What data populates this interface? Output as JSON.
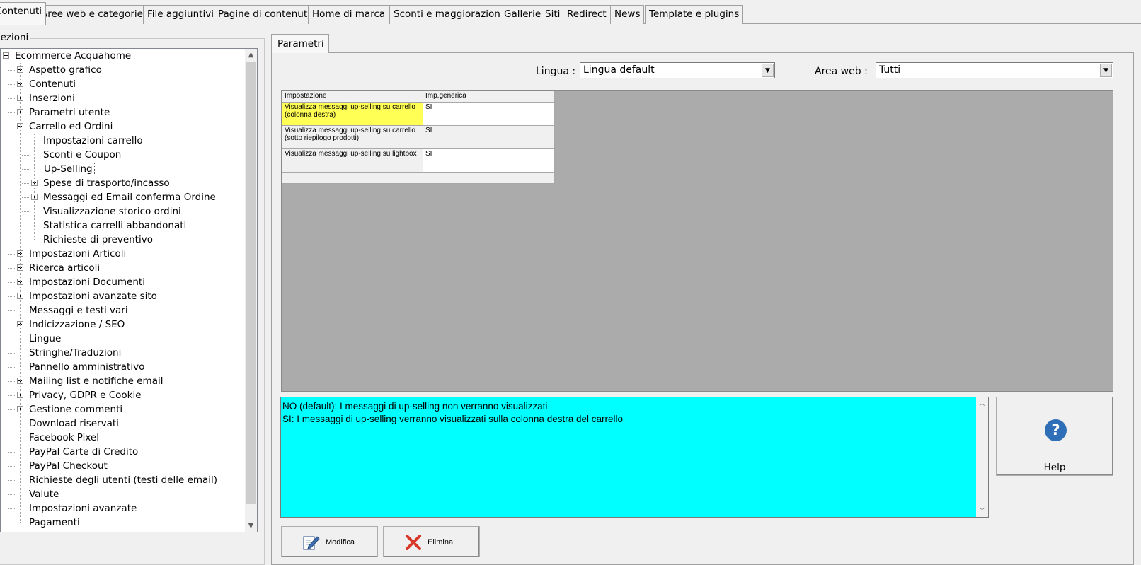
{
  "tabs": [
    {
      "label": "Contenuti",
      "active": true
    },
    {
      "label": "Aree web e categorie"
    },
    {
      "label": "File aggiuntivi"
    },
    {
      "label": "Pagine di contenuti"
    },
    {
      "label": "Home di marca"
    },
    {
      "label": "Sconti e maggiorazioni"
    },
    {
      "label": "Gallerie"
    },
    {
      "label": "Siti"
    },
    {
      "label": "Redirect"
    },
    {
      "label": "News"
    },
    {
      "label": "Template e plugins"
    }
  ],
  "sidebar": {
    "legend": "Sezioni",
    "tree": [
      {
        "label": "Ecommerce Acquahome",
        "level": 0,
        "toggle": "minus"
      },
      {
        "label": "Aspetto grafico",
        "level": 1,
        "toggle": "plus"
      },
      {
        "label": "Contenuti",
        "level": 1,
        "toggle": "plus"
      },
      {
        "label": "Inserzioni",
        "level": 1,
        "toggle": "plus"
      },
      {
        "label": "Parametri utente",
        "level": 1,
        "toggle": "plus"
      },
      {
        "label": "Carrello ed Ordini",
        "level": 1,
        "toggle": "minus"
      },
      {
        "label": "Impostazioni carrello",
        "level": 2
      },
      {
        "label": "Sconti e Coupon",
        "level": 2
      },
      {
        "label": "Up-Selling",
        "level": 2,
        "selected": true
      },
      {
        "label": "Spese di trasporto/incasso",
        "level": 2,
        "toggle": "plus"
      },
      {
        "label": "Messaggi ed Email conferma Ordine",
        "level": 2,
        "toggle": "plus"
      },
      {
        "label": "Visualizzazione storico ordini",
        "level": 2
      },
      {
        "label": "Statistica carrelli abbandonati",
        "level": 2
      },
      {
        "label": "Richieste di preventivo",
        "level": 2
      },
      {
        "label": "Impostazioni Articoli",
        "level": 1,
        "toggle": "plus"
      },
      {
        "label": "Ricerca articoli",
        "level": 1,
        "toggle": "plus"
      },
      {
        "label": "Impostazioni Documenti",
        "level": 1,
        "toggle": "plus"
      },
      {
        "label": "Impostazioni avanzate sito",
        "level": 1,
        "toggle": "plus"
      },
      {
        "label": "Messaggi e testi vari",
        "level": 1
      },
      {
        "label": "Indicizzazione / SEO",
        "level": 1,
        "toggle": "plus"
      },
      {
        "label": "Lingue",
        "level": 1
      },
      {
        "label": "Stringhe/Traduzioni",
        "level": 1
      },
      {
        "label": "Pannello amministrativo",
        "level": 1
      },
      {
        "label": "Mailing list e notifiche email",
        "level": 1,
        "toggle": "plus"
      },
      {
        "label": "Privacy, GDPR e Cookie",
        "level": 1,
        "toggle": "plus"
      },
      {
        "label": "Gestione commenti",
        "level": 1,
        "toggle": "plus"
      },
      {
        "label": "Download riservati",
        "level": 1
      },
      {
        "label": "Facebook Pixel",
        "level": 1
      },
      {
        "label": "PayPal Carte di Credito",
        "level": 1
      },
      {
        "label": "PayPal Checkout",
        "level": 1
      },
      {
        "label": "Richieste degli utenti (testi delle email)",
        "level": 1
      },
      {
        "label": "Valute",
        "level": 1
      },
      {
        "label": "Impostazioni avanzate",
        "level": 1
      },
      {
        "label": "Pagamenti",
        "level": 1
      }
    ]
  },
  "panel": {
    "tab_label": "Parametri",
    "lingua_label": "Lingua :",
    "lingua_value": "Lingua default",
    "area_label": "Area web :",
    "area_value": "Tutti"
  },
  "grid": {
    "headers": [
      "Impostazione",
      "Imp.generica"
    ],
    "rows": [
      {
        "name": "Visualizza messaggi up-selling su carrello (colonna destra)",
        "value": "SI"
      },
      {
        "name": "Visualizza messaggi up-selling su carrello (sotto riepilogo prodotti)",
        "value": "SI"
      },
      {
        "name": "Visualizza messaggi up-selling su lightbox",
        "value": "SI"
      }
    ]
  },
  "description": {
    "line1": "NO (default): I messaggi di up-selling non verranno visualizzati",
    "line2": "SI: I messaggi di up-selling verranno visualizzati sulla colonna destra del carrello"
  },
  "buttons": {
    "help": "Help",
    "modifica": "Modifica",
    "elimina": "Elimina"
  },
  "colors": {
    "highlight_row": "#ffff55",
    "description_bg": "#00ffff",
    "grid_bg": "#ababab"
  }
}
